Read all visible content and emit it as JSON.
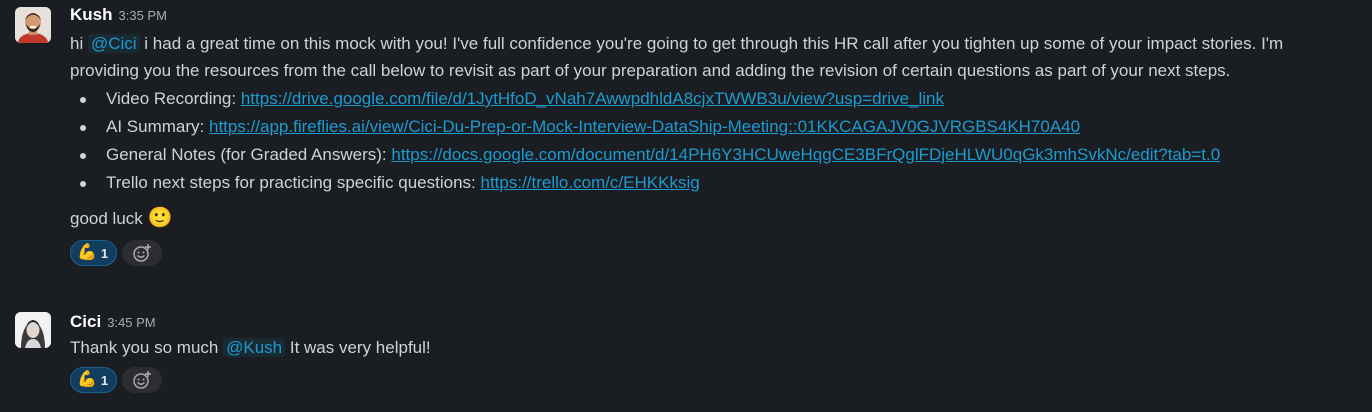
{
  "messages": [
    {
      "author": "Kush",
      "time": "3:35 PM",
      "avatar": "avatar-kush",
      "intro_prefix": "hi",
      "mention": "@Cici",
      "intro_text": "i had a great time on this mock with you! I've full confidence you're going to get through this HR call after you tighten up some of your impact stories. I'm providing you the resources from the call below to revisit as part of your preparation and adding the revision of certain questions as part of your next steps.",
      "links": [
        {
          "label": "Video Recording:",
          "url": "https://drive.google.com/file/d/1JytHfoD_vNah7AwwpdhldA8cjxTWWB3u/view?usp=drive_link"
        },
        {
          "label": "AI Summary:",
          "url": "https://app.fireflies.ai/view/Cici-Du-Prep-or-Mock-Interview-DataShip-Meeting::01KKCAGAJV0GJVRGBS4KH70A40"
        },
        {
          "label": "General Notes (for Graded Answers):",
          "url": "https://docs.google.com/document/d/14PH6Y3HCUweHqgCE3BFrQglFDjeHLWU0qGk3mhSvkNc/edit?tab=t.0"
        },
        {
          "label": "Trello next steps for practicing specific questions:",
          "url": "https://trello.com/c/EHKKksig"
        }
      ],
      "closing": "good luck",
      "closing_emoji": "🙂",
      "reaction": {
        "emoji": "💪",
        "count": "1"
      }
    },
    {
      "author": "Cici",
      "time": "3:45 PM",
      "avatar": "avatar-cici",
      "prefix": "Thank you so much",
      "mention": "@Kush",
      "suffix": "It was very helpful!",
      "reaction": {
        "emoji": "💪",
        "count": "1"
      }
    }
  ],
  "colors": {
    "background": "#1a1d21",
    "text": "#d1d2d3",
    "link": "#1d9bd1",
    "reaction_bg": "#113d5e"
  }
}
